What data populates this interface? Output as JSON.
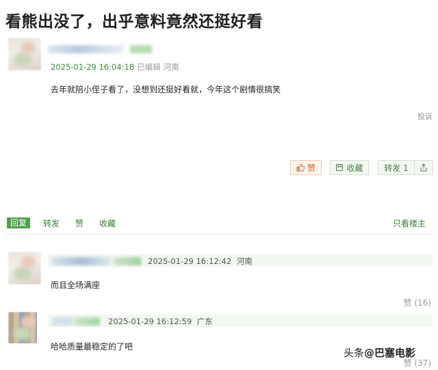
{
  "title": "看熊出没了，出乎意料竟然还挺好看",
  "post": {
    "time": "2025-01-29 16:04:18",
    "edited": "已编辑",
    "location": "河南",
    "content": "去年就陪小侄子看了，没想到还挺好看就，今年这个剧情很搞笑",
    "report": "投诉",
    "actions": {
      "like": "赞",
      "favorite": "收藏",
      "forward": "转发 1",
      "share_icon": "share-icon"
    }
  },
  "tabs": {
    "reply": "回复",
    "forward": "转发",
    "like": "赞",
    "favorite": "收藏",
    "only_author": "只看楼主"
  },
  "comments": [
    {
      "time": "2025-01-29 16:12:42",
      "location": "河南",
      "content": "而且全场满座",
      "likes": "赞 (16)"
    },
    {
      "time": "2025-01-29 16:12:59",
      "location": "广东",
      "content": "哈哈质量最稳定的了吧",
      "likes": "赞 (37)"
    }
  ],
  "watermark": {
    "prefix": "头条",
    "handle": "@巴塞电影"
  },
  "colors": {
    "accent_green": "#4ea04a",
    "time_green": "#3b8a3b",
    "like_orange": "#d0602d"
  }
}
